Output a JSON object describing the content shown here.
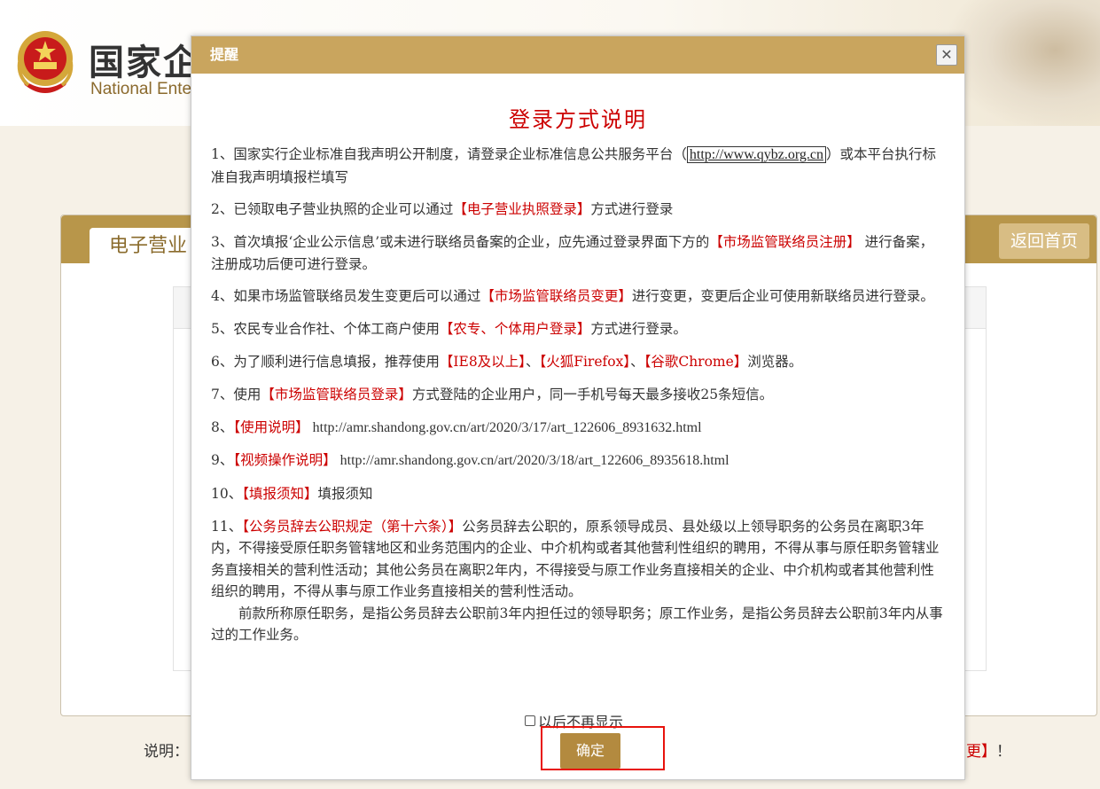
{
  "site": {
    "title": "国家企",
    "subtitle": "National Ente"
  },
  "panel": {
    "tab_label": "电子营业",
    "back_button": "返回首页"
  },
  "footer_note": {
    "left": "说明：",
    "right_red": "更】",
    "right_tail": "！"
  },
  "modal": {
    "title": "提醒",
    "close_icon": "close-icon",
    "heading": "登录方式说明",
    "items": [
      {
        "a": "1、国家实行企业标准自我声明公开制度，请登录企业标准信息公共服务平台（",
        "link": "http://www.qybz.org.cn",
        "b": "）或本平台执行标准自我声明填报栏填写"
      },
      {
        "a": "2、已领取电子营业执照的企业可以通过",
        "red": "【电子营业执照登录】",
        "b": "方式进行登录"
      },
      {
        "a": "3、首次填报‘企业公示信息’或未进行联络员备案的企业，应先通过登录界面下方的",
        "red": "【市场监管联络员注册】",
        "b": " 进行备案，注册成功后便可进行登录。"
      },
      {
        "a": "4、如果市场监管联络员发生变更后可以通过",
        "red": "【市场监管联络员变更】",
        "b": "进行变更，变更后企业可使用新联络员进行登录。"
      },
      {
        "a": "5、农民专业合作社、个体工商户使用",
        "red": "【农专、个体用户登录】",
        "b": "方式进行登录。"
      },
      {
        "a": "6、为了顺利进行信息填报，推荐使用",
        "red1": "【IE8及以上】",
        "sep1": "、",
        "red2": "【火狐Firefox】",
        "sep2": "、",
        "red3": "【谷歌Chrome】",
        "b": "浏览器。"
      },
      {
        "a": "7、使用",
        "red": "【市场监管联络员登录】",
        "b": "方式登陆的企业用户，同一手机号每天最多接收25条短信。"
      },
      {
        "a": "8、",
        "red": "【使用说明】",
        "url": " http://amr.shandong.gov.cn/art/2020/3/17/art_122606_8931632.html"
      },
      {
        "a": "9、",
        "red": "【视频操作说明】",
        "url": " http://amr.shandong.gov.cn/art/2020/3/18/art_122606_8935618.html"
      },
      {
        "a": "10、",
        "red": "【填报须知】",
        "b": "填报须知"
      },
      {
        "a": "11、",
        "red": "【公务员辞去公职规定（第十六条）】",
        "b": "公务员辞去公职的，原系领导成员、县处级以上领导职务的公务员在离职3年内，不得接受原任职务管辖地区和业务范围内的企业、中介机构或者其他营利性组织的聘用，不得从事与原任职务管辖业务直接相关的营利性活动；其他公务员在离职2年内，不得接受与原工作业务直接相关的企业、中介机构或者其他营利性组织的聘用，不得从事与原工作业务直接相关的营利性活动。",
        "c": "前款所称原任职务，是指公务员辞去公职前3年内担任过的领导职务；原工作业务，是指公务员辞去公职前3年内从事过的工作业务。"
      }
    ],
    "dont_show_label": "以后不再显示",
    "dont_show_checked": false,
    "ok_button": "确定"
  }
}
